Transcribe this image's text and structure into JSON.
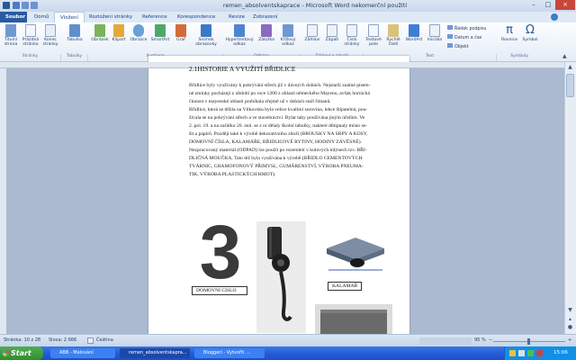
{
  "window": {
    "title": "remen_absolventskaprace - Microsoft Word nekomerční použití",
    "controls": [
      "–",
      "□",
      "×"
    ]
  },
  "ribbon": {
    "tabs": [
      "Soubor",
      "Domů",
      "Vložení",
      "Rozložení stránky",
      "Reference",
      "Korespondence",
      "Revize",
      "Zobrazení"
    ],
    "active_tab": "Vložení",
    "buttons": {
      "titulni": "Titulní strana",
      "prazdna": "Prázdná stránka",
      "konec": "Konec stránky",
      "tabulka": "Tabulka",
      "obrazek": "Obrázek",
      "klipart": "Klipart",
      "obrazce": "Obrazce",
      "smartart": "SmartArt",
      "graf": "Graf",
      "snimek": "Snímek obrazovky",
      "hypertext": "Hypertextový odkaz",
      "zalozka": "Záložka",
      "krizovy": "Křížový odkaz",
      "zahlavi": "Záhlaví",
      "zapati": "Zápatí",
      "cislo": "Číslo stránky",
      "textove": "Textové pole",
      "rychle": "Rychlé části",
      "wordart": "WordArt",
      "iniciala": "Iniciála",
      "radek_podpisu": "Řádek podpisu",
      "datum": "Datum a čas",
      "objekt": "Objekt",
      "rovnice": "Rovnice",
      "symbol": "Symbol"
    },
    "groups": {
      "stranky": "Stránky",
      "tabulky": "Tabulky",
      "ilustrace": "Ilustrace",
      "odkazy": "Odkazy",
      "zahlavi_zapati": "Záhlaví a zápatí",
      "text": "Text",
      "symboly": "Symboly"
    }
  },
  "document": {
    "heading": "2.1HISTORIE A VYUŽITÍ BŘIDLICE",
    "lines": [
      "Břidlice byly využívány k pokrývání střech již v dávných dobách. Nejstarší známé písem-",
      "né zmínky pocházejí z období po roce 1200 z oblasti německého Mayenu, avšak hornická",
      "činnost v mayenské oblasti probíhala zřejmě už v dobách staří římanů.",
      "Břidlice, která se těžila na Vítkovsku byla velice kvalitní surovina, lehce štípatelná, pou-",
      "žívala se na pokrývání střech a ve stavebnictví. Bylat taky používána jiným účelům. Ve",
      "2. pol. 19. a na začátku 20. stol. se z ní dělaly školní tabulky, nakteré důtipnaly místo se-",
      "šit a papírů. Později také k výrobě dekorativního zboží (BROUSKY NA SRPY A KOSY,",
      "DOMOVNÍ ČÍSLA, KALAMÁŘE, BŘIDLICOVÉ RYTINY, HODINY ZÁVĚSNÉ).",
      "Nezpracovaný materiál (ODPAD) lze použít po rozemletí v kulových mlýnech tzv. BŘI-",
      "DLIČNÁ MOUČKA. Tato též byla využívána k výrobě (BŘIDLO CEMENTOVÝCH",
      "TVÁRNIC, GRAMOFONOVÝ PŘIMYSL, GUMÁRENSTVÍ, VÝROBA PNEUMA-",
      "TIK, VÝROBA PLASTICKÝCH HMOT)."
    ],
    "image_number": "3",
    "captions": {
      "domovni": "DOMOVNI CISLO",
      "kalamar": "KALAMAŘ"
    }
  },
  "statusbar": {
    "page": "Stránka: 10 z 28",
    "words": "Slova: 2 666",
    "language": "Čeština",
    "zoom": "95 %"
  },
  "taskbar": {
    "start": "Start",
    "tasks": [
      "ABB - Malování",
      "remen_absolventskapra...",
      "Bloggeri - Vytvořit ..."
    ],
    "clock": "15:06"
  },
  "colors": {
    "ribbon_blue": "#15428b",
    "taskbar_blue": "#245edb",
    "start_green": "#2f8f2f",
    "underline_red": "#d03030"
  }
}
